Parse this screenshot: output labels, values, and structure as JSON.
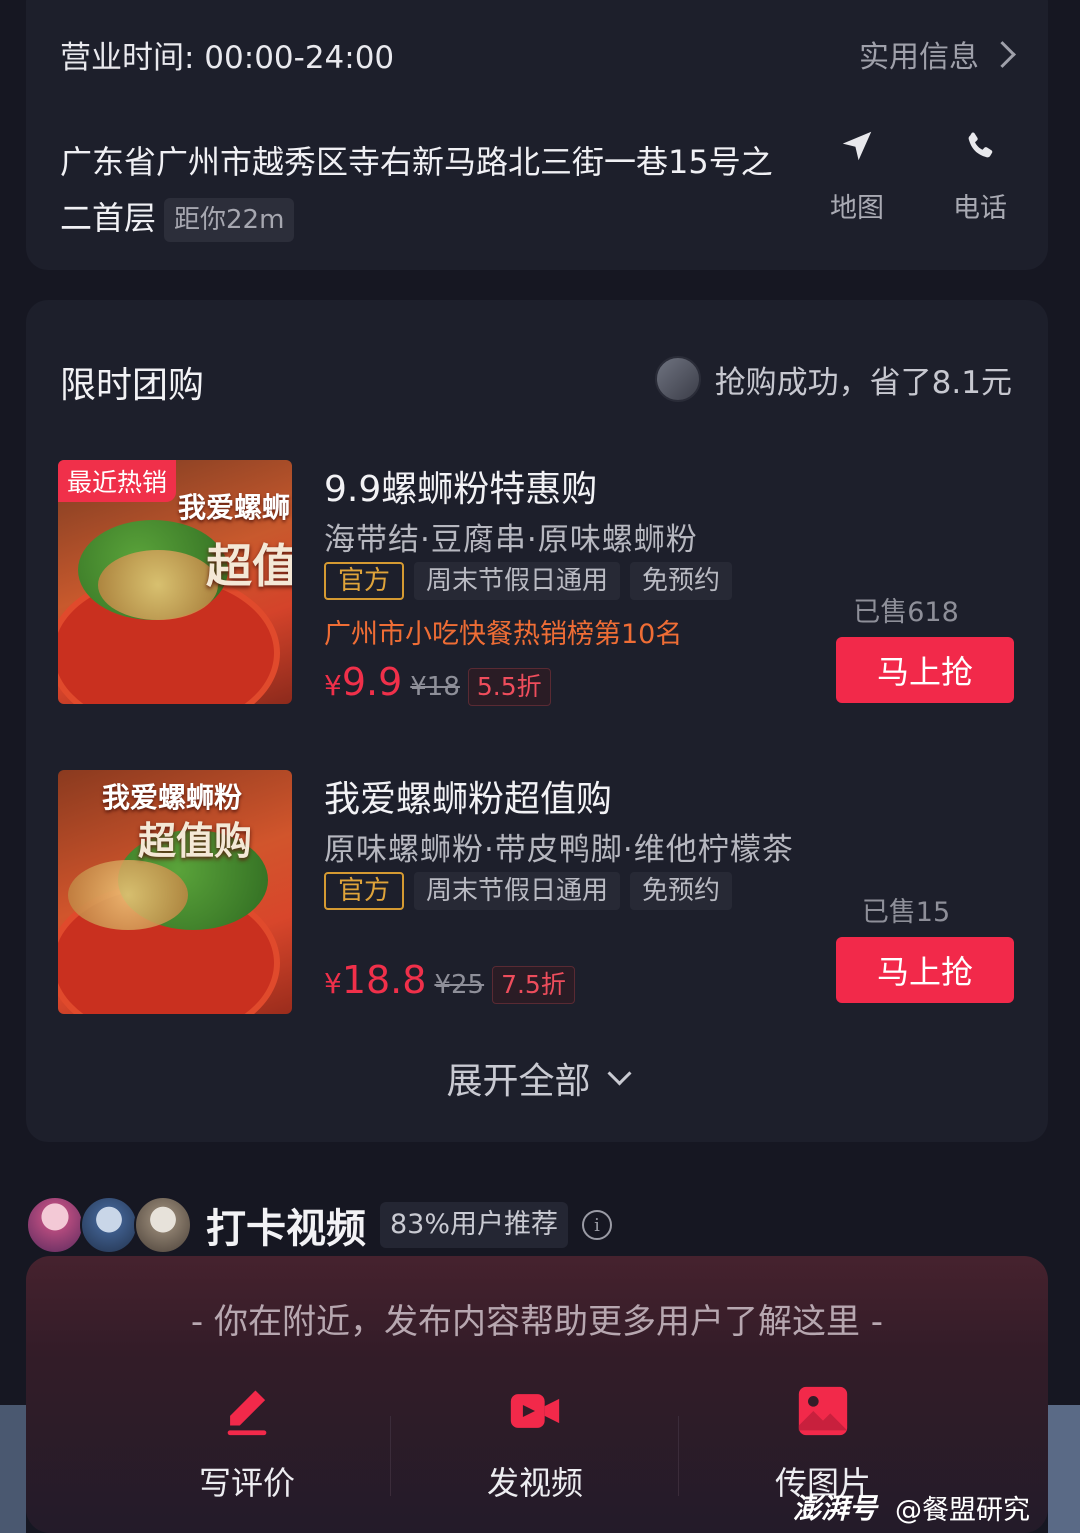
{
  "store": {
    "hours": "营业时间: 00:00-24:00",
    "info_link": "实用信息",
    "address": "广东省广州市越秀区寺右新马路北三街一巷15号之二首层",
    "distance": "距你22m",
    "map_label": "地图",
    "phone_label": "电话"
  },
  "group_buy": {
    "title": "限时团购",
    "promo_text": "抢购成功，省了8.1元",
    "deals": [
      {
        "badge": "最近热销",
        "image_text_1": "我爱螺蛳",
        "image_text_2": "超值",
        "title": "9.9螺蛳粉特惠购",
        "subtitle": "海带结·豆腐串·原味螺蛳粉",
        "tags": [
          "官方",
          "周末节假日通用",
          "免预约"
        ],
        "rank": "广州市小吃快餐热销榜第10名",
        "currency": "¥",
        "price": "9.9",
        "original_price": "¥18",
        "discount": "5.5折",
        "sold": "已售618",
        "buy_label": "马上抢"
      },
      {
        "badge": "",
        "image_text_1": "我爱螺蛳粉",
        "image_text_2": "超值购",
        "title": "我爱螺蛳粉超值购",
        "subtitle": "原味螺蛳粉·带皮鸭脚·维他柠檬茶",
        "tags": [
          "官方",
          "周末节假日通用",
          "免预约"
        ],
        "rank": "",
        "currency": "¥",
        "price": "18.8",
        "original_price": "¥25",
        "discount": "7.5折",
        "sold": "已售15",
        "buy_label": "马上抢"
      }
    ],
    "expand_label": "展开全部"
  },
  "checkin": {
    "title": "打卡视频",
    "recommend": "83%用户推荐",
    "info_icon": "i"
  },
  "bottom": {
    "hint": "- 你在附近，发布内容帮助更多用户了解这里 -",
    "actions": [
      {
        "label": "写评价",
        "icon": "pen-icon"
      },
      {
        "label": "发视频",
        "icon": "video-camera-icon"
      },
      {
        "label": "传图片",
        "icon": "image-icon"
      }
    ]
  },
  "watermark": {
    "brand": "澎湃号",
    "author": "@餐盟研究"
  },
  "colors": {
    "accent": "#f2294a",
    "orange": "#ef6d35",
    "gold": "#d59a32",
    "background": "#161722",
    "card": "#1d1f2b"
  }
}
